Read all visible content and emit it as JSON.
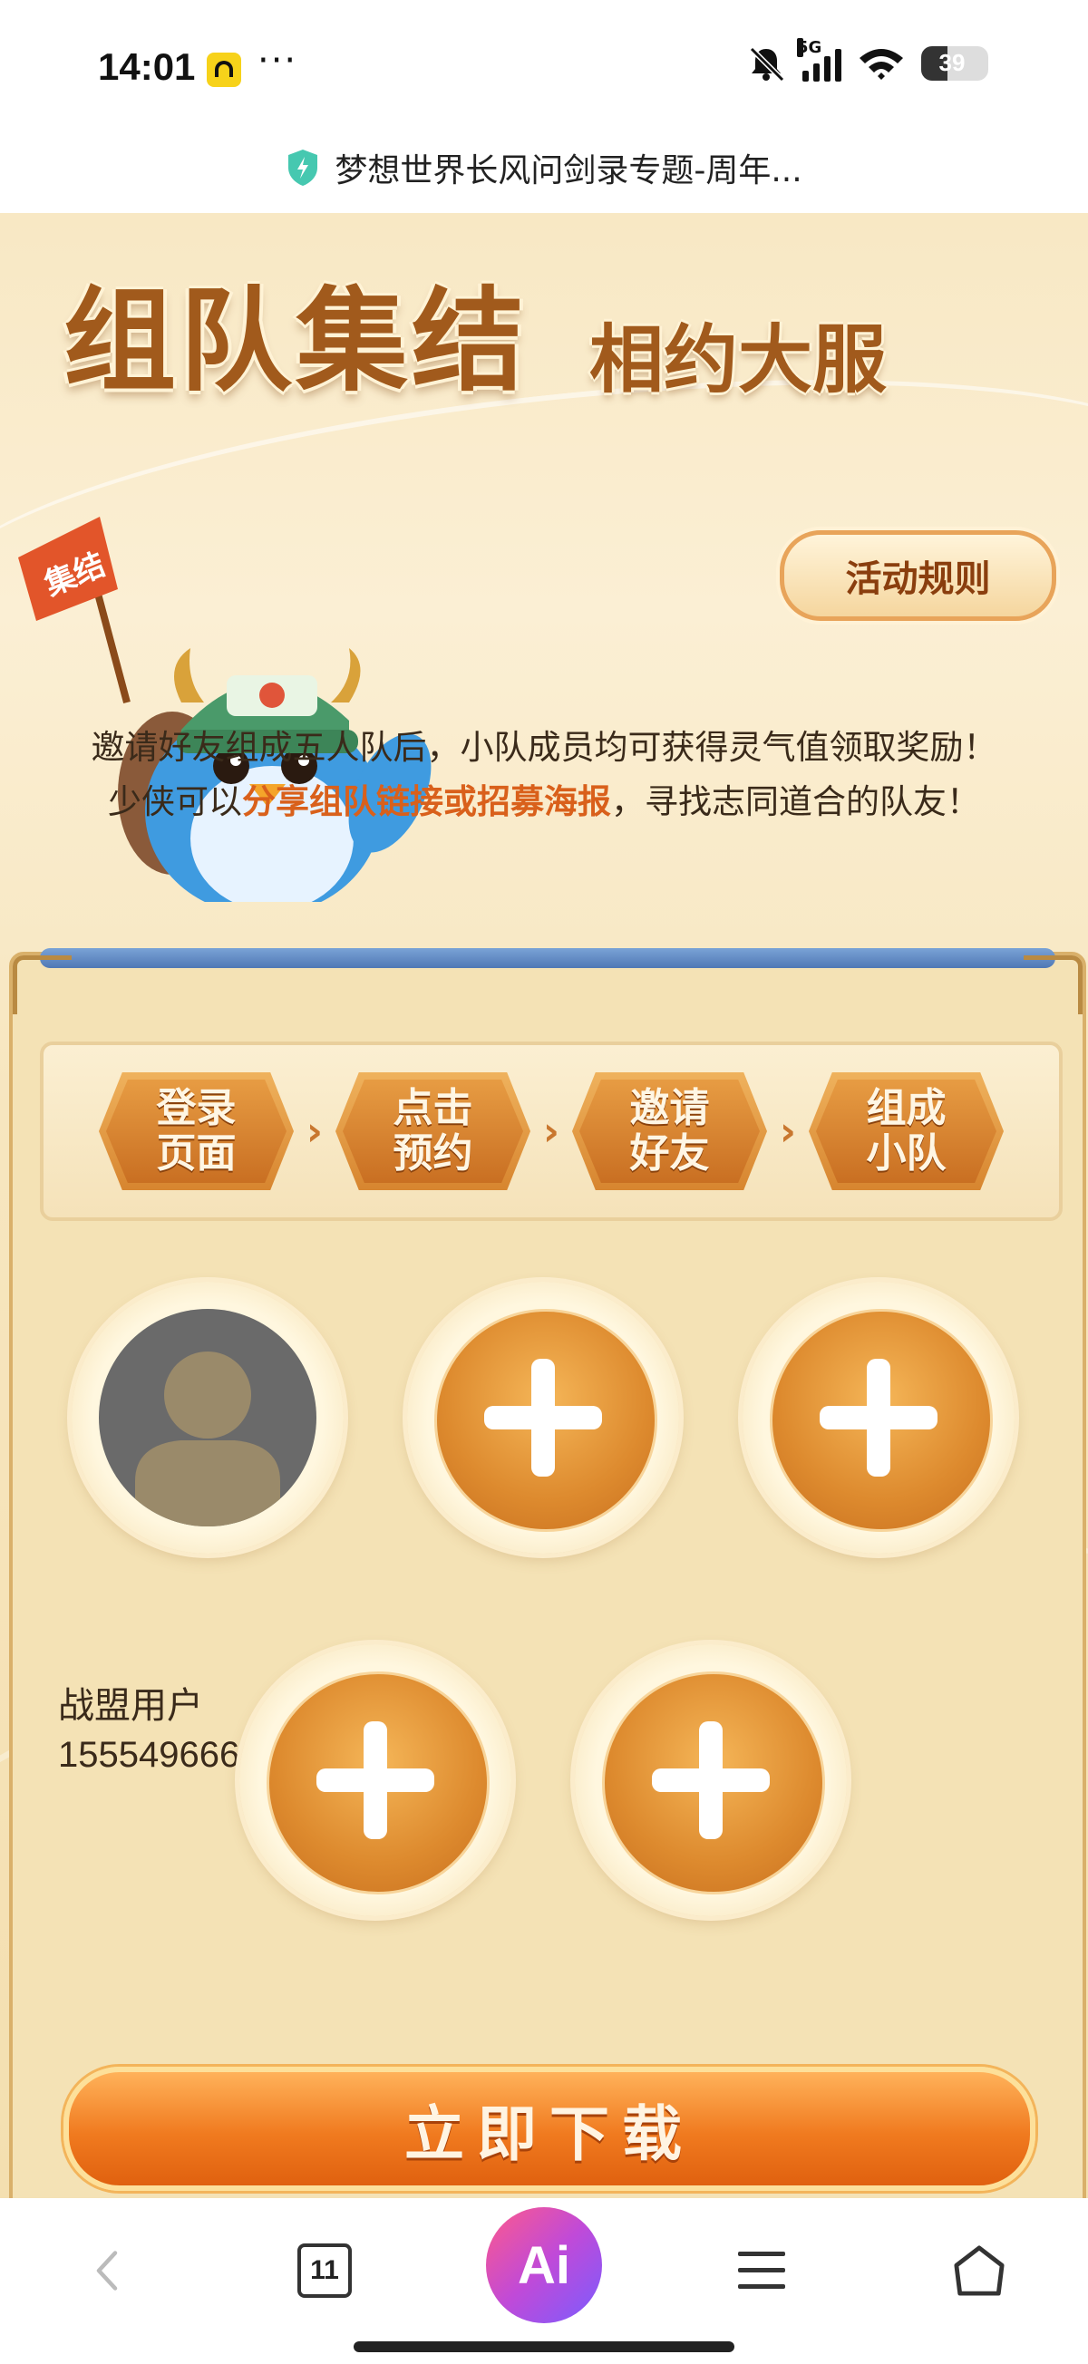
{
  "status_bar": {
    "time": "14:01",
    "network": "5G",
    "battery": "39",
    "battery_level": 0.39
  },
  "browser": {
    "page_title": "梦想世界长风问剑录专题-周年..."
  },
  "banner": {
    "title": "组队集结",
    "subtitle": "相约大服",
    "flag_text": "集结",
    "rules_button": "活动规则"
  },
  "description": {
    "line1": "邀请好友组成五人队后，小队成员均可获得灵气值领取奖励！",
    "line2_prefix": "少侠可以",
    "line2_highlight": "分享组队链接或招募海报",
    "line2_suffix": "，寻找志同道合的队友！"
  },
  "steps": [
    {
      "label": "登录页面"
    },
    {
      "label": "点击预约"
    },
    {
      "label": "邀请好友"
    },
    {
      "label": "组成小队"
    }
  ],
  "team": {
    "member_name": "战盟用户",
    "member_id": "155549666"
  },
  "download_button": "立即下载",
  "bottom_nav": {
    "tab_count": "11",
    "ai_label": "Ai"
  }
}
